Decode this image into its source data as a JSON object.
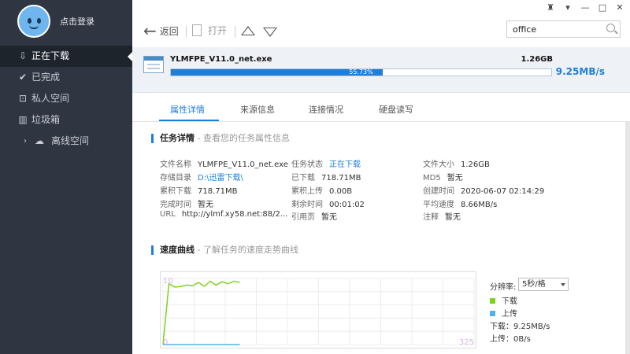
{
  "sidebar": {
    "login_label": "点击登录",
    "items": [
      {
        "label": "正在下载",
        "icon": "download-icon"
      },
      {
        "label": "已完成",
        "icon": "check-circle-icon"
      },
      {
        "label": "私人空间",
        "icon": "lock-icon"
      },
      {
        "label": "垃圾箱",
        "icon": "trash-icon"
      },
      {
        "label": "离线空间",
        "icon": "cloud-icon"
      }
    ]
  },
  "toolbar": {
    "back_label": "返回",
    "open_label": "打开",
    "search_value": "office"
  },
  "task": {
    "filename": "YLMFPE_V11.0_net.exe",
    "size": "1.26GB",
    "progress_percent": 55.73,
    "progress_label": "55.73%",
    "speed": "9.25MB/s"
  },
  "tabs": [
    "属性详情",
    "来源信息",
    "连接情况",
    "硬盘读写"
  ],
  "task_details": {
    "title": "任务详情",
    "subtitle": " - 查看您的任务属性信息",
    "col1": [
      {
        "k": "文件名称",
        "v": "YLMFPE_V11.0_net.exe"
      },
      {
        "k": "存储目录",
        "v": "D:\\迅雷下载\\"
      },
      {
        "k": "累积下载",
        "v": "718.71MB"
      },
      {
        "k": "完成时间",
        "v": "暂无"
      },
      {
        "k": "URL",
        "v": "http://ylmf.xy58.net:88/2..."
      }
    ],
    "col2": [
      {
        "k": "任务状态",
        "v": "正在下载"
      },
      {
        "k": "已下载",
        "v": "718.71MB"
      },
      {
        "k": "累积上传",
        "v": "0.00B"
      },
      {
        "k": "剩余时间",
        "v": "00:01:02"
      },
      {
        "k": "引用页",
        "v": "暂无"
      }
    ],
    "col3": [
      {
        "k": "文件大小",
        "v": "1.26GB"
      },
      {
        "k": "MD5",
        "v": "暂无"
      },
      {
        "k": "创建时间",
        "v": "2020-06-07 02:14:29"
      },
      {
        "k": "平均速度",
        "v": "8.66MB/s"
      },
      {
        "k": "注释",
        "v": "暂无"
      }
    ]
  },
  "speed_curve": {
    "title": "速度曲线",
    "subtitle": " - 了解任务的速度走势曲线",
    "scale_label": "分辨率:",
    "scale_value": "5秒/格",
    "legend_download": "下载",
    "legend_upload": "上传",
    "download_speed": "下载：9.25MB/s",
    "upload_speed": "上传：0B/s",
    "y_max_label": "10",
    "y_min_label": "0",
    "x_max_label": "325"
  },
  "colors": {
    "accent": "#1f7ed8",
    "download_series": "#7ed321",
    "upload_series": "#4fb3e8"
  },
  "chart_data": {
    "type": "line",
    "ylim": [
      0,
      10
    ],
    "series": [
      {
        "name": "下载",
        "color": "#7ed321",
        "values": [
          0,
          9.2,
          8.7,
          8.8,
          9.0,
          8.9,
          9.4,
          8.8,
          9.6,
          9.0,
          9.5,
          9.2,
          9.6,
          9.4
        ]
      },
      {
        "name": "上传",
        "color": "#4fb3e8",
        "values": [
          0,
          0,
          0,
          0,
          0,
          0,
          0,
          0,
          0,
          0,
          0,
          0,
          0,
          0
        ]
      }
    ]
  }
}
